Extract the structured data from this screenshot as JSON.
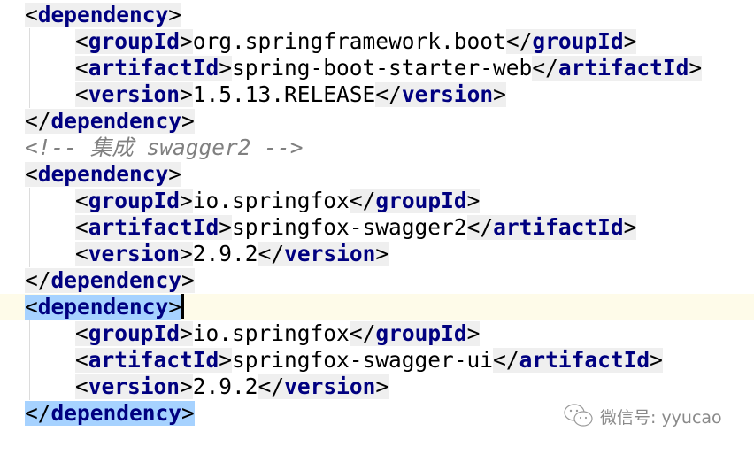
{
  "editor": {
    "lines": [
      {
        "indent": 0,
        "tokens": [
          {
            "k": "tag",
            "slash": false,
            "name": "dependency"
          }
        ]
      },
      {
        "indent": 1,
        "tokens": [
          {
            "k": "tag",
            "slash": false,
            "name": "groupId"
          },
          {
            "k": "txt",
            "text": "org.springframework.boot"
          },
          {
            "k": "tag",
            "slash": true,
            "name": "groupId"
          }
        ]
      },
      {
        "indent": 1,
        "tokens": [
          {
            "k": "tag",
            "slash": false,
            "name": "artifactId"
          },
          {
            "k": "txt",
            "text": "spring-boot-starter-web"
          },
          {
            "k": "tag",
            "slash": true,
            "name": "artifactId"
          }
        ]
      },
      {
        "indent": 1,
        "tokens": [
          {
            "k": "tag",
            "slash": false,
            "name": "version"
          },
          {
            "k": "txt",
            "text": "1.5.13.RELEASE"
          },
          {
            "k": "tag",
            "slash": true,
            "name": "version"
          }
        ]
      },
      {
        "indent": 0,
        "tokens": [
          {
            "k": "tag",
            "slash": true,
            "name": "dependency"
          }
        ]
      },
      {
        "indent": 0,
        "tokens": [
          {
            "k": "comment",
            "text": "<!-- 集成 swagger2 -->"
          }
        ]
      },
      {
        "indent": 0,
        "tokens": [
          {
            "k": "tag",
            "slash": false,
            "name": "dependency"
          }
        ]
      },
      {
        "indent": 1,
        "tokens": [
          {
            "k": "tag",
            "slash": false,
            "name": "groupId"
          },
          {
            "k": "txt",
            "text": "io.springfox"
          },
          {
            "k": "tag",
            "slash": true,
            "name": "groupId"
          }
        ]
      },
      {
        "indent": 1,
        "tokens": [
          {
            "k": "tag",
            "slash": false,
            "name": "artifactId"
          },
          {
            "k": "txt",
            "text": "springfox-swagger2"
          },
          {
            "k": "tag",
            "slash": true,
            "name": "artifactId"
          }
        ]
      },
      {
        "indent": 1,
        "tokens": [
          {
            "k": "tag",
            "slash": false,
            "name": "version"
          },
          {
            "k": "txt",
            "text": "2.9.2"
          },
          {
            "k": "tag",
            "slash": true,
            "name": "version"
          }
        ]
      },
      {
        "indent": 0,
        "tokens": [
          {
            "k": "tag",
            "slash": true,
            "name": "dependency"
          }
        ]
      },
      {
        "indent": 0,
        "current": true,
        "tokens": [
          {
            "k": "tag",
            "slash": false,
            "name": "dependency",
            "sel": true
          },
          {
            "k": "caret"
          }
        ]
      },
      {
        "indent": 1,
        "tokens": [
          {
            "k": "tag",
            "slash": false,
            "name": "groupId"
          },
          {
            "k": "txt",
            "text": "io.springfox"
          },
          {
            "k": "tag",
            "slash": true,
            "name": "groupId"
          }
        ]
      },
      {
        "indent": 1,
        "tokens": [
          {
            "k": "tag",
            "slash": false,
            "name": "artifactId"
          },
          {
            "k": "txt",
            "text": "springfox-swagger-ui"
          },
          {
            "k": "tag",
            "slash": true,
            "name": "artifactId"
          }
        ]
      },
      {
        "indent": 1,
        "tokens": [
          {
            "k": "tag",
            "slash": false,
            "name": "version"
          },
          {
            "k": "txt",
            "text": "2.9.2"
          },
          {
            "k": "tag",
            "slash": true,
            "name": "version"
          }
        ]
      },
      {
        "indent": 0,
        "tokens": [
          {
            "k": "tag",
            "slash": true,
            "name": "dependency",
            "sel": true
          }
        ]
      }
    ]
  },
  "watermark": {
    "text": "微信号: yyucao",
    "icon": "wechat-icon"
  },
  "colors": {
    "tag_name": "#000080",
    "tag_bg": "#efefef",
    "selection": "#a6d2ff",
    "current_line": "#fefbe9",
    "comment": "#808080"
  }
}
